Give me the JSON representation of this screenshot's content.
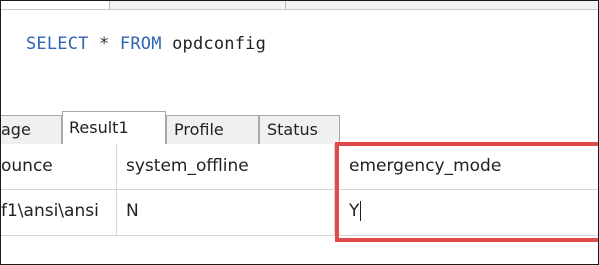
{
  "editor": {
    "query": {
      "kw_select": "SELECT",
      "star": "*",
      "kw_from": "FROM",
      "table": "opdconfig"
    }
  },
  "result_tabs": [
    {
      "label": "age"
    },
    {
      "label": "Result1",
      "active": true
    },
    {
      "label": "Profile"
    },
    {
      "label": "Status"
    }
  ],
  "grid": {
    "columns": [
      "ounce",
      "system_offline",
      "emergency_mode"
    ],
    "rows": [
      [
        "f1\\ansi\\ansi",
        "N",
        "Y"
      ]
    ]
  },
  "colors": {
    "keyword": "#2f63b5",
    "highlight": "#e24b4b"
  }
}
